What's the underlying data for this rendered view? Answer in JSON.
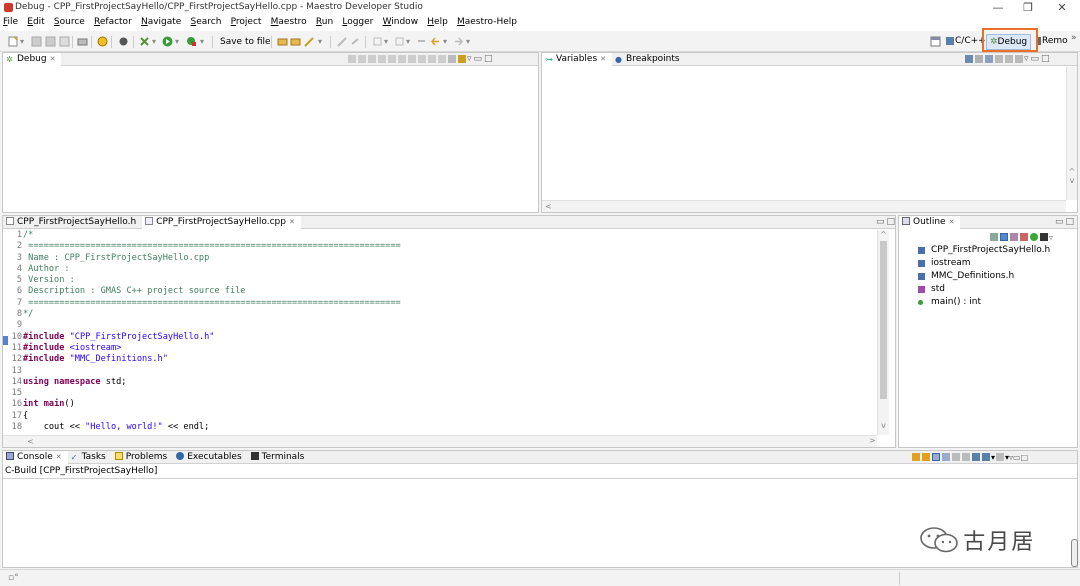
{
  "window": {
    "title": "Debug - CPP_FirstProjectSayHello/CPP_FirstProjectSayHello.cpp - Maestro Developer Studio",
    "minimize": "—",
    "restore": "❐",
    "close": "✕"
  },
  "menu": [
    "File",
    "Edit",
    "Source",
    "Refactor",
    "Navigate",
    "Search",
    "Project",
    "Maestro",
    "Run",
    "Logger",
    "Window",
    "Help",
    "Maestro-Help"
  ],
  "toolbar": {
    "save_to_file": "Save to file",
    "perspectives": {
      "cpp": "C/C++",
      "debug": "Debug",
      "remote": "Remo",
      "more": "»"
    }
  },
  "debug_view": {
    "tab": "Debug"
  },
  "variables_view": {
    "tabs": [
      "Variables",
      "Breakpoints"
    ]
  },
  "editor": {
    "tabs": [
      "CPP_FirstProjectSayHello.h",
      "CPP_FirstProjectSayHello.cpp"
    ],
    "lines": [
      {
        "n": "1",
        "parts": [
          {
            "t": "/*",
            "c": "comment"
          }
        ]
      },
      {
        "n": "2",
        "parts": [
          {
            "t": " ========================================================================",
            "c": "comment"
          }
        ]
      },
      {
        "n": "3",
        "parts": [
          {
            "t": " Name : CPP_FirstProjectSayHello.cpp",
            "c": "comment"
          }
        ]
      },
      {
        "n": "4",
        "parts": [
          {
            "t": " Author :",
            "c": "comment"
          }
        ]
      },
      {
        "n": "5",
        "parts": [
          {
            "t": " Version :",
            "c": "comment"
          }
        ]
      },
      {
        "n": "6",
        "parts": [
          {
            "t": " Description : GMAS C++ project source file",
            "c": "comment"
          }
        ]
      },
      {
        "n": "7",
        "parts": [
          {
            "t": " ========================================================================",
            "c": "comment"
          }
        ]
      },
      {
        "n": "8",
        "parts": [
          {
            "t": "*/",
            "c": "comment"
          }
        ]
      },
      {
        "n": "9",
        "parts": []
      },
      {
        "n": "10",
        "parts": [
          {
            "t": "#include",
            "c": "keyword"
          },
          {
            "t": " ",
            "c": "plain"
          },
          {
            "t": "\"CPP_FirstProjectSayHello.h\"",
            "c": "string"
          }
        ]
      },
      {
        "n": "11",
        "parts": [
          {
            "t": "#include",
            "c": "keyword"
          },
          {
            "t": " ",
            "c": "plain"
          },
          {
            "t": "<iostream>",
            "c": "string"
          }
        ]
      },
      {
        "n": "12",
        "parts": [
          {
            "t": "#include",
            "c": "keyword"
          },
          {
            "t": " ",
            "c": "plain"
          },
          {
            "t": "\"MMC_Definitions.h\"",
            "c": "string"
          }
        ]
      },
      {
        "n": "13",
        "parts": []
      },
      {
        "n": "14",
        "parts": [
          {
            "t": "using namespace",
            "c": "keyword"
          },
          {
            "t": " std;",
            "c": "plain"
          }
        ]
      },
      {
        "n": "15",
        "parts": []
      },
      {
        "n": "16",
        "parts": [
          {
            "t": "int",
            "c": "keyword"
          },
          {
            "t": " ",
            "c": "plain"
          },
          {
            "t": "main",
            "c": "keyword"
          },
          {
            "t": "()",
            "c": "plain"
          }
        ]
      },
      {
        "n": "17",
        "parts": [
          {
            "t": "{",
            "c": "plain"
          }
        ]
      },
      {
        "n": "18",
        "parts": [
          {
            "t": "    cout << ",
            "c": "plain"
          },
          {
            "t": "\"Hello, world!\"",
            "c": "string"
          },
          {
            "t": " << endl;",
            "c": "plain"
          }
        ]
      }
    ]
  },
  "outline": {
    "tab": "Outline",
    "items": [
      {
        "label": "CPP_FirstProjectSayHello.h",
        "kind": "include"
      },
      {
        "label": "iostream",
        "kind": "include"
      },
      {
        "label": "MMC_Definitions.h",
        "kind": "include"
      },
      {
        "label": "std",
        "kind": "namespace"
      },
      {
        "label": "main() : int",
        "kind": "function"
      }
    ]
  },
  "console": {
    "tabs": [
      "Console",
      "Tasks",
      "Problems",
      "Executables",
      "Terminals"
    ],
    "header": "C-Build [CPP_FirstProjectSayHello]"
  },
  "watermark": {
    "text": "古月居"
  },
  "colors": {
    "highlight": "#e8702a",
    "comment": "#3f7f5f",
    "keyword": "#7f0055",
    "string": "#2a00ff"
  }
}
